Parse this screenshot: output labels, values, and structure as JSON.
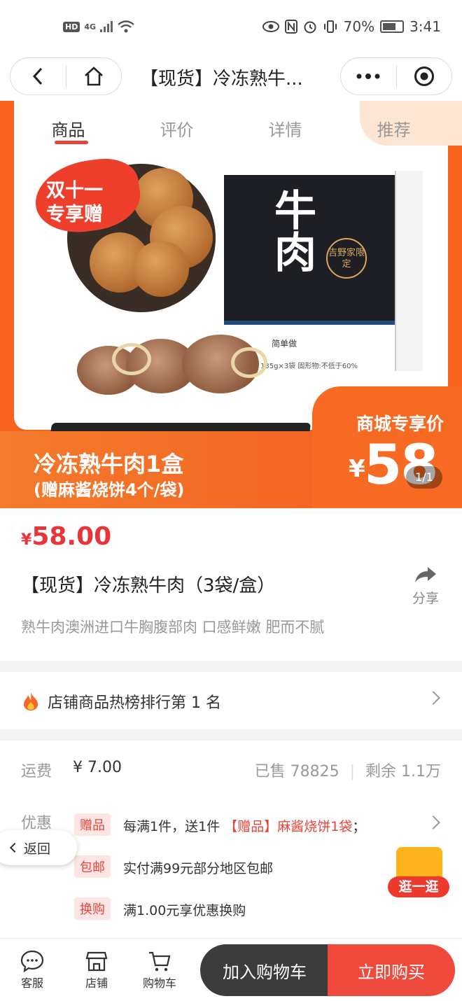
{
  "status_bar": {
    "hd": "HD",
    "network": "4G",
    "battery": "70%",
    "time": "3:41"
  },
  "nav": {
    "title": "【现货】冷冻熟牛..."
  },
  "tabs": [
    "商品",
    "评价",
    "详情",
    "推荐"
  ],
  "hero": {
    "badge_line1": "双十一",
    "badge_line2": "专享赠",
    "box_title": "牛肉",
    "box_badge": "吉野家限定",
    "box_brand": "简单做",
    "box_spec": "135g×3袋 固形物:不低于60%",
    "banner_title": "冷冻熟牛肉1盒",
    "banner_sub": "(赠麻酱烧饼4个/袋)",
    "price_tag_label": "商城专享价",
    "price_tag_yen": "¥",
    "price_tag_value": "58",
    "pager": "1/1"
  },
  "product": {
    "price_symbol": "¥",
    "price": "58.00",
    "title": "【现货】冷冻熟牛肉（3袋/盒）",
    "share_label": "分享",
    "description": "熟牛肉澳洲进口牛胸腹部肉 口感鲜嫩 肥而不腻"
  },
  "ranking": {
    "text": "店铺商品热榜排行第 1 名"
  },
  "shipping": {
    "label": "运费",
    "value": "¥ 7.00",
    "sold": "已售 78825",
    "remaining": "剩余 1.1万",
    "promo_label": "优惠",
    "promos": [
      {
        "tag": "赠品",
        "text": "每满1件，送1件 ",
        "highlight": "【赠品】麻酱烧饼1袋",
        "suffix": "；"
      },
      {
        "tag": "包邮",
        "text": "实付满99元部分地区包邮",
        "highlight": "",
        "suffix": ""
      },
      {
        "tag": "换购",
        "text": "满1.00元享优惠换购",
        "highlight": "",
        "suffix": ""
      }
    ]
  },
  "floating": {
    "back": "返回",
    "stroll": "逛一逛"
  },
  "bottom_bar": {
    "service": "客服",
    "shop": "店铺",
    "cart": "购物车",
    "add_to_cart": "加入购物车",
    "buy_now": "立即购买"
  }
}
